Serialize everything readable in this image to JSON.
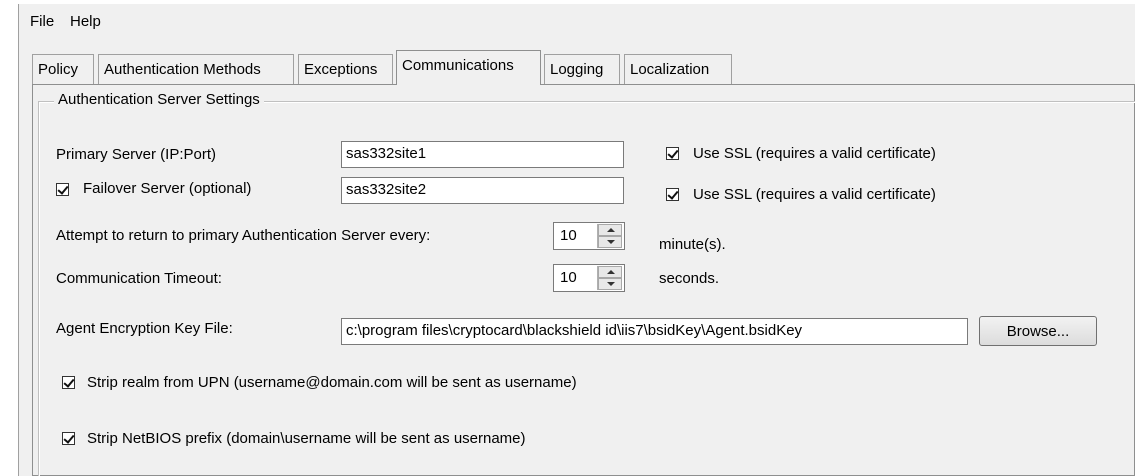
{
  "menu": [
    "File",
    "Help"
  ],
  "tabs": [
    "Policy",
    "Authentication Methods",
    "Exceptions",
    "Communications",
    "Logging",
    "Localization"
  ],
  "active_tab": "Communications",
  "group": {
    "title": "Authentication Server Settings",
    "primary_label": "Primary Server (IP:Port)",
    "primary_value": "sas332site1",
    "primary_ssl_label": "Use SSL (requires a valid certificate)",
    "primary_ssl_checked": true,
    "failover_label": "Failover Server (optional)",
    "failover_checked": true,
    "failover_value": "sas332site2",
    "failover_ssl_label": "Use SSL (requires a valid certificate)",
    "failover_ssl_checked": true,
    "attempt_label": "Attempt to return to primary Authentication Server every:",
    "attempt_value": "10",
    "attempt_unit": "minute(s).",
    "timeout_label": "Communication Timeout:",
    "timeout_value": "10",
    "timeout_unit": "seconds.",
    "keyfile_label": "Agent Encryption Key File:",
    "keyfile_value": "c:\\program files\\cryptocard\\blackshield id\\iis7\\bsidKey\\Agent.bsidKey",
    "browse_label": "Browse...",
    "strip_realm_label": "Strip realm from UPN (username@domain.com will be sent as username)",
    "strip_realm_checked": true,
    "strip_netbios_label": "Strip NetBIOS prefix (domain\\username will be sent as username)",
    "strip_netbios_checked": true
  }
}
